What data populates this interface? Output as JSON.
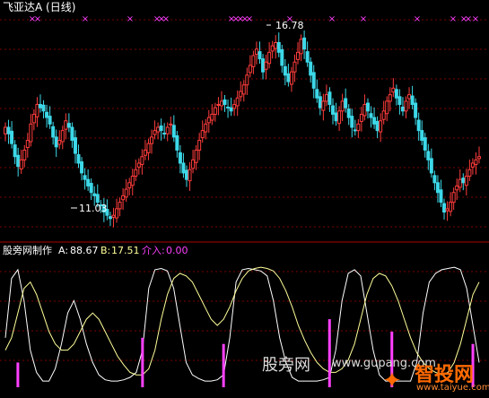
{
  "window": {
    "title": "飞亚达A (日线)"
  },
  "price_panel": {
    "high_label": "16.78",
    "low_label": "11.03",
    "marker_glyph": "×",
    "marker_count": 20
  },
  "indicator_panel": {
    "name": "股旁网制作",
    "a_label": "A:",
    "a_value": "88.67",
    "b_label": "B:",
    "b_value": "17.51",
    "c_label": "介入:",
    "c_value": "0.00"
  },
  "watermark": {
    "site_text": "股旁网",
    "site_url": "www.gupang.com",
    "brand_cn": "智投网",
    "brand_url": "www.taiyue.com"
  },
  "colors": {
    "up": "#ff3c3c",
    "down": "#3cd8e8",
    "grid": "#7a0000",
    "line_a": "#ffffff",
    "line_b": "#ffff99",
    "signal": "#ff40ff",
    "accent_magenta": "#ff40ff"
  },
  "chart_data": [
    {
      "type": "candlestick",
      "title": "飞亚达A (日线)",
      "ylim": [
        10.6,
        17.2
      ],
      "annotations": [
        {
          "text": "16.78",
          "y": 16.78
        },
        {
          "text": "11.03",
          "y": 11.03
        }
      ],
      "close": [
        13.9,
        13.7,
        13.4,
        13.0,
        12.7,
        12.9,
        13.2,
        13.5,
        14.0,
        14.3,
        14.6,
        14.5,
        14.4,
        14.2,
        14.0,
        13.6,
        13.3,
        13.5,
        13.8,
        14.1,
        13.9,
        13.5,
        13.1,
        12.8,
        12.5,
        12.3,
        12.1,
        11.9,
        11.8,
        11.6,
        11.5,
        11.3,
        11.2,
        11.1,
        11.2,
        11.4,
        11.6,
        11.8,
        12.0,
        12.2,
        12.4,
        12.6,
        12.8,
        13.0,
        13.2,
        13.4,
        13.6,
        13.8,
        13.9,
        13.8,
        13.7,
        13.9,
        14.0,
        13.6,
        13.2,
        12.8,
        12.5,
        12.3,
        12.6,
        12.9,
        13.2,
        13.5,
        13.8,
        14.0,
        14.2,
        14.3,
        14.5,
        14.6,
        14.7,
        14.6,
        14.5,
        14.4,
        14.6,
        14.8,
        15.0,
        15.2,
        15.5,
        15.8,
        16.1,
        16.3,
        16.0,
        15.6,
        15.9,
        16.2,
        16.4,
        16.5,
        16.2,
        15.8,
        15.5,
        15.3,
        15.6,
        15.9,
        16.2,
        16.6,
        16.3,
        15.9,
        15.5,
        15.1,
        14.8,
        14.5,
        14.7,
        14.9,
        14.6,
        14.3,
        14.1,
        14.4,
        14.7,
        14.5,
        14.2,
        13.9,
        13.8,
        14.0,
        14.3,
        14.6,
        14.4,
        14.2,
        14.0,
        13.8,
        14.1,
        14.4,
        14.7,
        14.9,
        15.1,
        14.8,
        14.6,
        14.4,
        14.7,
        14.9,
        14.6,
        14.2,
        13.8,
        13.5,
        13.2,
        12.9,
        12.5,
        12.2,
        11.9,
        11.6,
        11.3,
        11.4,
        11.6,
        11.9,
        12.1,
        12.3,
        12.2,
        12.4,
        12.6,
        12.8,
        12.9,
        13.0
      ]
    },
    {
      "type": "line",
      "title": "股旁网制作",
      "ylim": [
        0,
        100
      ],
      "series": [
        {
          "name": "A",
          "values": [
            40,
            88,
            95,
            70,
            30,
            12,
            5,
            5,
            15,
            35,
            60,
            70,
            55,
            35,
            20,
            10,
            6,
            5,
            5,
            6,
            8,
            12,
            30,
            80,
            95,
            96,
            94,
            80,
            50,
            20,
            10,
            7,
            5,
            5,
            6,
            10,
            40,
            85,
            95,
            96,
            95,
            94,
            90,
            70,
            40,
            20,
            8,
            5,
            5,
            5,
            5,
            6,
            8,
            30,
            70,
            92,
            95,
            90,
            60,
            30,
            10,
            5,
            5,
            5,
            5,
            5,
            20,
            60,
            85,
            92,
            95,
            96,
            97,
            95,
            80,
            50,
            20
          ]
        },
        {
          "name": "B",
          "values": [
            30,
            40,
            60,
            80,
            85,
            75,
            60,
            45,
            35,
            30,
            30,
            35,
            45,
            55,
            60,
            55,
            45,
            35,
            25,
            18,
            12,
            10,
            10,
            15,
            30,
            55,
            75,
            88,
            92,
            90,
            85,
            75,
            65,
            55,
            50,
            55,
            65,
            78,
            88,
            94,
            96,
            97,
            96,
            94,
            88,
            78,
            65,
            50,
            38,
            28,
            20,
            15,
            12,
            12,
            15,
            22,
            35,
            55,
            75,
            88,
            92,
            90,
            82,
            70,
            55,
            40,
            28,
            20,
            15,
            12,
            10,
            12,
            20,
            35,
            55,
            75,
            85
          ]
        },
        {
          "name": "介入",
          "values": [
            0,
            0,
            20,
            0,
            0,
            0,
            0,
            0,
            0,
            0,
            0,
            0,
            0,
            0,
            0,
            0,
            0,
            0,
            0,
            0,
            0,
            0,
            40,
            0,
            0,
            0,
            0,
            0,
            0,
            0,
            0,
            0,
            0,
            0,
            0,
            35,
            0,
            0,
            0,
            0,
            0,
            0,
            0,
            0,
            0,
            0,
            0,
            0,
            0,
            0,
            0,
            0,
            55,
            0,
            0,
            0,
            0,
            0,
            0,
            0,
            0,
            0,
            45,
            0,
            0,
            0,
            0,
            0,
            0,
            0,
            0,
            0,
            0,
            0,
            0,
            35,
            0
          ]
        }
      ]
    }
  ]
}
